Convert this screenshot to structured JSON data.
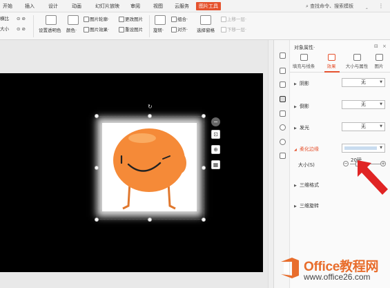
{
  "menu": {
    "tabs": [
      "开始",
      "插入",
      "设计",
      "动画",
      "幻灯片放映",
      "审阅",
      "视图",
      "云服务",
      "图片工具"
    ],
    "active_tab": "图片工具",
    "search": "查找命令、搜索模板",
    "accent": "#e5522e"
  },
  "ribbon": {
    "partial_left_top": "横比",
    "partial_left_bottom": "大小",
    "transparent": "设置透明色",
    "color": "颜色·",
    "outline": "图片轮廓·",
    "effects": "图片效果·",
    "change_picture": "更改图片",
    "reset_picture": "重设图片",
    "rotate": "旋转·",
    "group": "组合·",
    "align": "对齐·",
    "selection_pane": "选择窗格",
    "bring_forward": "上移一层·",
    "send_backward": "下移一层·"
  },
  "panel": {
    "title": "对象属性·",
    "tabs": [
      "填充与线条",
      "效果",
      "大小与属性",
      "图片"
    ],
    "active_tab": "效果",
    "rows": {
      "shadow": "阴影",
      "reflection": "倒影",
      "glow": "发光",
      "soft_edges": "柔化边缘",
      "format_3d": "三维格式",
      "rotation_3d": "三维旋转"
    },
    "select_none": "无",
    "size_label": "大小(S)",
    "size_value": "20磅",
    "soft_edge_color": "#c9dcef"
  },
  "watermark": {
    "line1": "Office教程网",
    "line2": "www.office26.com",
    "color": "#e86d2c"
  }
}
